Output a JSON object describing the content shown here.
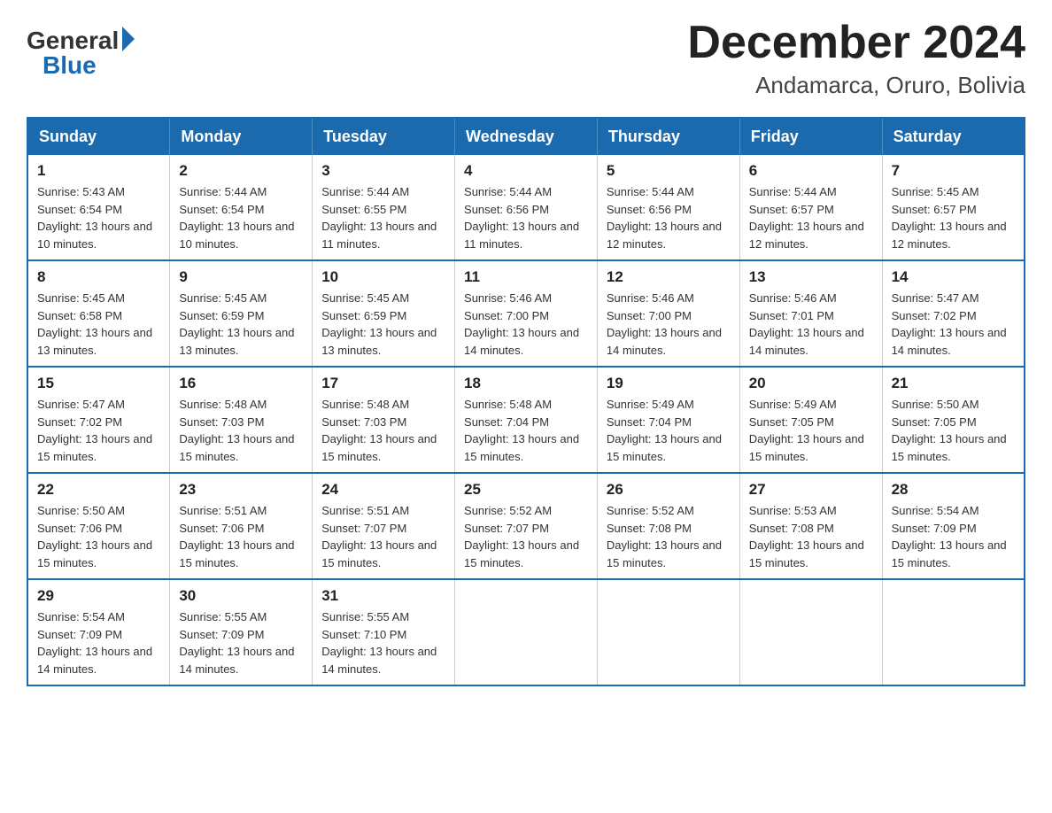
{
  "header": {
    "logo": {
      "general": "General",
      "blue": "Blue"
    },
    "title": "December 2024",
    "location": "Andamarca, Oruro, Bolivia"
  },
  "calendar": {
    "days_of_week": [
      "Sunday",
      "Monday",
      "Tuesday",
      "Wednesday",
      "Thursday",
      "Friday",
      "Saturday"
    ],
    "weeks": [
      [
        {
          "day": "1",
          "sunrise": "5:43 AM",
          "sunset": "6:54 PM",
          "daylight": "13 hours and 10 minutes."
        },
        {
          "day": "2",
          "sunrise": "5:44 AM",
          "sunset": "6:54 PM",
          "daylight": "13 hours and 10 minutes."
        },
        {
          "day": "3",
          "sunrise": "5:44 AM",
          "sunset": "6:55 PM",
          "daylight": "13 hours and 11 minutes."
        },
        {
          "day": "4",
          "sunrise": "5:44 AM",
          "sunset": "6:56 PM",
          "daylight": "13 hours and 11 minutes."
        },
        {
          "day": "5",
          "sunrise": "5:44 AM",
          "sunset": "6:56 PM",
          "daylight": "13 hours and 12 minutes."
        },
        {
          "day": "6",
          "sunrise": "5:44 AM",
          "sunset": "6:57 PM",
          "daylight": "13 hours and 12 minutes."
        },
        {
          "day": "7",
          "sunrise": "5:45 AM",
          "sunset": "6:57 PM",
          "daylight": "13 hours and 12 minutes."
        }
      ],
      [
        {
          "day": "8",
          "sunrise": "5:45 AM",
          "sunset": "6:58 PM",
          "daylight": "13 hours and 13 minutes."
        },
        {
          "day": "9",
          "sunrise": "5:45 AM",
          "sunset": "6:59 PM",
          "daylight": "13 hours and 13 minutes."
        },
        {
          "day": "10",
          "sunrise": "5:45 AM",
          "sunset": "6:59 PM",
          "daylight": "13 hours and 13 minutes."
        },
        {
          "day": "11",
          "sunrise": "5:46 AM",
          "sunset": "7:00 PM",
          "daylight": "13 hours and 14 minutes."
        },
        {
          "day": "12",
          "sunrise": "5:46 AM",
          "sunset": "7:00 PM",
          "daylight": "13 hours and 14 minutes."
        },
        {
          "day": "13",
          "sunrise": "5:46 AM",
          "sunset": "7:01 PM",
          "daylight": "13 hours and 14 minutes."
        },
        {
          "day": "14",
          "sunrise": "5:47 AM",
          "sunset": "7:02 PM",
          "daylight": "13 hours and 14 minutes."
        }
      ],
      [
        {
          "day": "15",
          "sunrise": "5:47 AM",
          "sunset": "7:02 PM",
          "daylight": "13 hours and 15 minutes."
        },
        {
          "day": "16",
          "sunrise": "5:48 AM",
          "sunset": "7:03 PM",
          "daylight": "13 hours and 15 minutes."
        },
        {
          "day": "17",
          "sunrise": "5:48 AM",
          "sunset": "7:03 PM",
          "daylight": "13 hours and 15 minutes."
        },
        {
          "day": "18",
          "sunrise": "5:48 AM",
          "sunset": "7:04 PM",
          "daylight": "13 hours and 15 minutes."
        },
        {
          "day": "19",
          "sunrise": "5:49 AM",
          "sunset": "7:04 PM",
          "daylight": "13 hours and 15 minutes."
        },
        {
          "day": "20",
          "sunrise": "5:49 AM",
          "sunset": "7:05 PM",
          "daylight": "13 hours and 15 minutes."
        },
        {
          "day": "21",
          "sunrise": "5:50 AM",
          "sunset": "7:05 PM",
          "daylight": "13 hours and 15 minutes."
        }
      ],
      [
        {
          "day": "22",
          "sunrise": "5:50 AM",
          "sunset": "7:06 PM",
          "daylight": "13 hours and 15 minutes."
        },
        {
          "day": "23",
          "sunrise": "5:51 AM",
          "sunset": "7:06 PM",
          "daylight": "13 hours and 15 minutes."
        },
        {
          "day": "24",
          "sunrise": "5:51 AM",
          "sunset": "7:07 PM",
          "daylight": "13 hours and 15 minutes."
        },
        {
          "day": "25",
          "sunrise": "5:52 AM",
          "sunset": "7:07 PM",
          "daylight": "13 hours and 15 minutes."
        },
        {
          "day": "26",
          "sunrise": "5:52 AM",
          "sunset": "7:08 PM",
          "daylight": "13 hours and 15 minutes."
        },
        {
          "day": "27",
          "sunrise": "5:53 AM",
          "sunset": "7:08 PM",
          "daylight": "13 hours and 15 minutes."
        },
        {
          "day": "28",
          "sunrise": "5:54 AM",
          "sunset": "7:09 PM",
          "daylight": "13 hours and 15 minutes."
        }
      ],
      [
        {
          "day": "29",
          "sunrise": "5:54 AM",
          "sunset": "7:09 PM",
          "daylight": "13 hours and 14 minutes."
        },
        {
          "day": "30",
          "sunrise": "5:55 AM",
          "sunset": "7:09 PM",
          "daylight": "13 hours and 14 minutes."
        },
        {
          "day": "31",
          "sunrise": "5:55 AM",
          "sunset": "7:10 PM",
          "daylight": "13 hours and 14 minutes."
        },
        null,
        null,
        null,
        null
      ]
    ],
    "labels": {
      "sunrise": "Sunrise:",
      "sunset": "Sunset:",
      "daylight": "Daylight:"
    }
  }
}
